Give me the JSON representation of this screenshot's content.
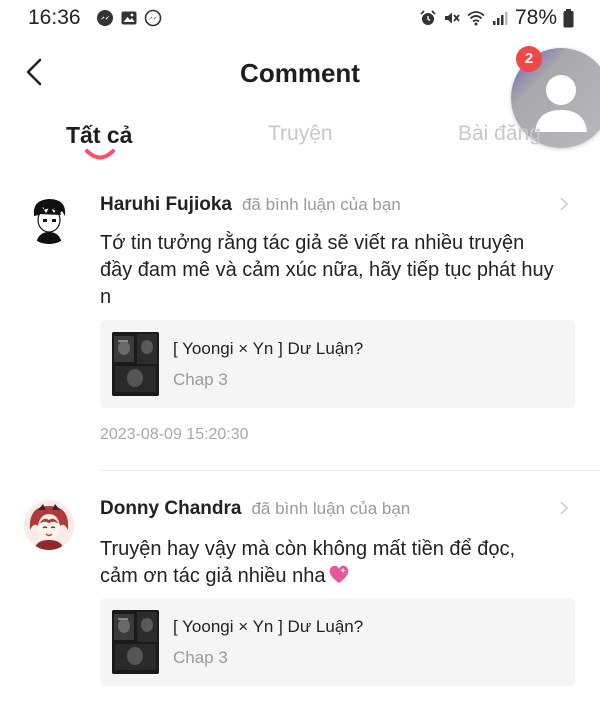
{
  "status_bar": {
    "time": "16:36",
    "battery": "78%",
    "left_icons": [
      "messenger-icon",
      "gallery-icon",
      "messenger-icon"
    ],
    "right_icons": [
      "alarm-icon",
      "mute-icon",
      "wifi-icon",
      "signal-icon",
      "battery-icon"
    ]
  },
  "header": {
    "title": "Comment",
    "notification_count": "2"
  },
  "tabs": [
    {
      "label": "Tất cả",
      "active": true
    },
    {
      "label": "Truyện",
      "active": false
    },
    {
      "label": "Bài đăng",
      "active": false
    }
  ],
  "comments": [
    {
      "user": "Haruhi Fujioka",
      "action": "đã bình luận của bạn",
      "text": "Tớ tin tưởng rằng tác giả sẽ viết ra nhiều truyện đầy đam mê và cảm xúc nữa, hãy tiếp tục phát huy n",
      "story_title": "[ Yoongi × Yn ] Dư Luận?",
      "story_chapter": "Chap 3",
      "timestamp": "2023-08-09 15:20:30"
    },
    {
      "user": "Donny Chandra",
      "action": "đã bình luận của bạn",
      "text_line1": "Truyện hay vậy mà còn không mất tiền để đọc,",
      "text_line2": "cảm ơn tác giả nhiều nha",
      "story_title": "[ Yoongi × Yn ] Dư Luận?",
      "story_chapter": "Chap 3"
    }
  ],
  "colors": {
    "accent": "#ff4d6d",
    "badge": "#f04747",
    "muted_text": "#9a9a9a",
    "card_bg": "#f5f5f5"
  }
}
